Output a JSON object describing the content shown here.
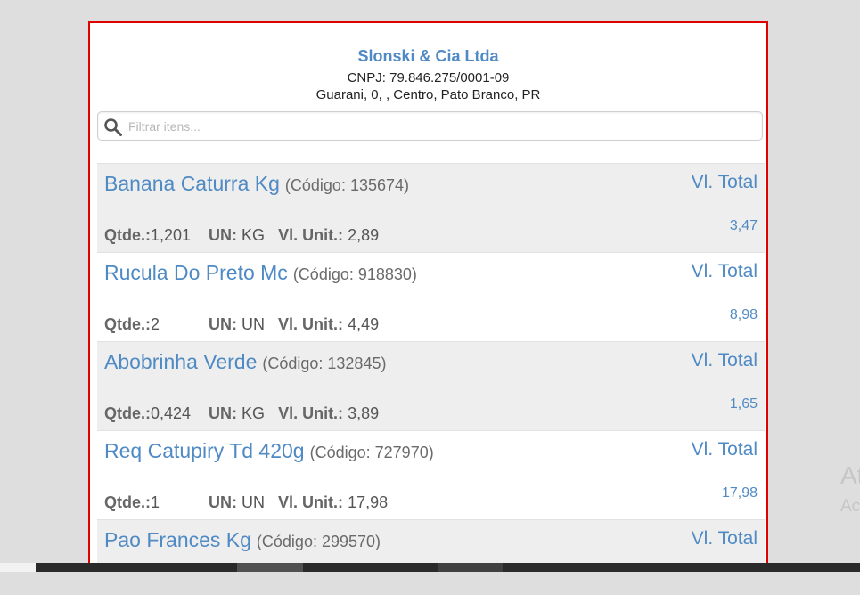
{
  "header": {
    "company": "Slonski & Cia Ltda",
    "cnpj": "CNPJ: 79.846.275/0001-09",
    "address": "Guarani, 0, , Centro, Pato Branco, PR"
  },
  "search": {
    "placeholder": "Filtrar itens..."
  },
  "labels": {
    "qty": "Qtde.:",
    "un": "UN:",
    "unit_price": "Vl. Unit.:",
    "total": "Vl. Total"
  },
  "items": [
    {
      "name": "Banana Caturra Kg",
      "code": "(Código: 135674)",
      "qty": "1,201",
      "un": "KG",
      "unit_price": "2,89",
      "total": "3,47"
    },
    {
      "name": "Rucula Do Preto Mc",
      "code": "(Código: 918830)",
      "qty": "2",
      "un": "UN",
      "unit_price": "4,49",
      "total": "8,98"
    },
    {
      "name": "Abobrinha Verde",
      "code": "(Código: 132845)",
      "qty": "0,424",
      "un": "KG",
      "unit_price": "3,89",
      "total": "1,65"
    },
    {
      "name": "Req Catupiry Td 420g",
      "code": "(Código: 727970)",
      "qty": "1",
      "un": "UN",
      "unit_price": "17,98",
      "total": "17,98"
    },
    {
      "name": "Pao Frances Kg",
      "code": "(Código: 299570)"
    }
  ],
  "background_text": {
    "line1": "At",
    "line2": "Ac"
  },
  "colors": {
    "accent": "#4f8ac4",
    "frame": "#e00000",
    "page_bg": "#dedede",
    "row_shade": "#eeeeee"
  }
}
